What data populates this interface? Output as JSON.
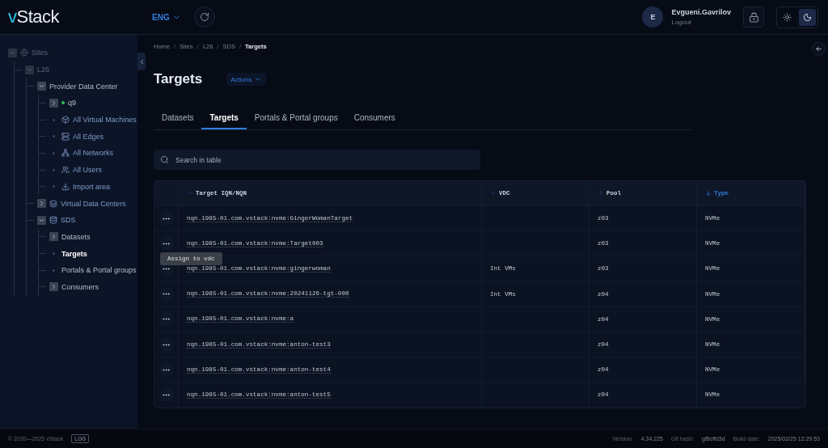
{
  "header": {
    "logo": {
      "accent": "v",
      "rest": "Stack"
    },
    "language": "ENG",
    "user": {
      "initial": "E",
      "name": "Evgueni.Gavrilov",
      "logout": "Logout"
    },
    "theme": [
      {
        "kind": "light",
        "selected": false
      },
      {
        "kind": "dark",
        "selected": true
      }
    ]
  },
  "sidebar": {
    "tree": [
      {
        "label": "Sites",
        "kind": "site",
        "expanded": true,
        "disabled": true,
        "selected": false,
        "children": [
          {
            "label": "L26",
            "expanded": true,
            "disabled": true,
            "selected": false,
            "children": [
              {
                "label": "Provider Data Center",
                "expanded": true,
                "disabled": false,
                "selected": false,
                "children": [
                  {
                    "label": "q9",
                    "kind": "host",
                    "expanded": false,
                    "disabled": false,
                    "selected": false,
                    "color": "#2fbf4a"
                  },
                  {
                    "label": "All Virtual Machines",
                    "kind": "vms",
                    "disabled": false,
                    "selected": false
                  },
                  {
                    "label": "All Edges",
                    "kind": "edges",
                    "disabled": false,
                    "selected": false
                  },
                  {
                    "label": "All Networks",
                    "kind": "networks",
                    "disabled": false,
                    "selected": false
                  },
                  {
                    "label": "All Users",
                    "kind": "users",
                    "disabled": false,
                    "selected": false
                  },
                  {
                    "label": "Import area",
                    "kind": "import",
                    "disabled": false,
                    "selected": false
                  }
                ]
              },
              {
                "label": "Virtual Data Centers",
                "kind": "vdc",
                "expanded": false,
                "disabled": false,
                "selected": false
              },
              {
                "label": "SDS",
                "kind": "sds",
                "expanded": true,
                "disabled": false,
                "selected": false,
                "children": [
                  {
                    "label": "Datasets",
                    "expanded": false,
                    "disabled": false,
                    "selected": false
                  },
                  {
                    "label": "Targets",
                    "disabled": false,
                    "selected": true
                  },
                  {
                    "label": "Portals & Portal groups",
                    "disabled": false,
                    "selected": false
                  },
                  {
                    "label": "Consumers",
                    "expanded": false,
                    "disabled": false,
                    "selected": false
                  }
                ]
              }
            ]
          }
        ]
      }
    ]
  },
  "breadcrumbs": {
    "separator": "/",
    "items": [
      "Home",
      "Sites",
      "L26",
      "SDS",
      "Targets"
    ]
  },
  "page": {
    "title": "Targets",
    "actions": "Actions"
  },
  "tabs": [
    {
      "label": "Datasets",
      "selected": false
    },
    {
      "label": "Targets",
      "selected": true
    },
    {
      "label": "Portals & Portal groups",
      "selected": false
    },
    {
      "label": "Consumers",
      "selected": false
    }
  ],
  "search": {
    "placeholder": "Search in table"
  },
  "table": {
    "columns": [
      {
        "label": "Target IQN/NQN",
        "sorted": false,
        "descending": false
      },
      {
        "label": "VDC",
        "sorted": false,
        "descending": false
      },
      {
        "label": "Pool",
        "sorted": false,
        "descending": false
      },
      {
        "label": "Type",
        "sorted": true,
        "descending": true
      }
    ],
    "rows": [
      {
        "iqn": "nqn.1985-01.com.vstack:nvme:GingerWomanTarget",
        "vdc": "",
        "pool": "z03",
        "type": "NVMe"
      },
      {
        "iqn": "nqn.1985-01.com.vstack:nvme:Target003",
        "vdc": "",
        "pool": "z03",
        "type": "NVMe",
        "tooltip": "Assign to vdc"
      },
      {
        "iqn": "nqn.1985-01.com.vstack:nvme:gingerwoman",
        "vdc": "Int VMs",
        "pool": "z03",
        "type": "NVMe"
      },
      {
        "iqn": "nqn.1985-01.com.vstack:nvme:20241126-tgt-000",
        "vdc": "Int VMs",
        "pool": "z04",
        "type": "NVMe"
      },
      {
        "iqn": "nqn.1985-01.com.vstack:nvme:a",
        "vdc": "",
        "pool": "z04",
        "type": "NVMe"
      },
      {
        "iqn": "nqn.1985-01.com.vstack:nvme:anton-test3",
        "vdc": "",
        "pool": "z04",
        "type": "NVMe"
      },
      {
        "iqn": "nqn.1985-01.com.vstack:nvme:anton-test4",
        "vdc": "",
        "pool": "z04",
        "type": "NVMe"
      },
      {
        "iqn": "nqn.1985-01.com.vstack:nvme:anton-test5",
        "vdc": "",
        "pool": "z04",
        "type": "NVMe"
      }
    ]
  },
  "footer": {
    "copyright": "© 2020—2025 vStack",
    "log": "LOG",
    "version_label": "Version:",
    "version": "4.34.225",
    "hash_label": "Git hash:",
    "hash": "gf8cffd3d",
    "build_label": "Build date:",
    "build": "2025/02/25 12:29:53"
  }
}
